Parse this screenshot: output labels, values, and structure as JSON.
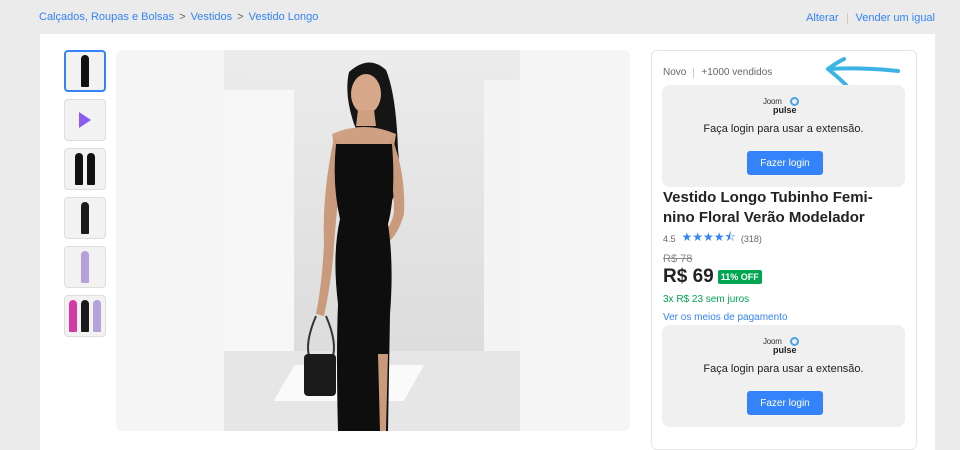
{
  "breadcrumb": {
    "items": [
      "Calçados, Roupas e Bolsas",
      "Vestidos",
      "Vestido Longo"
    ],
    "separator": ">"
  },
  "top_actions": {
    "edit_label": "Alterar",
    "sell_label": "Vender um igual"
  },
  "gallery": {
    "thumbnails": [
      "photo",
      "video",
      "photo",
      "photo",
      "photo",
      "photo"
    ]
  },
  "product": {
    "condition": "Novo",
    "sold": "+1000 vendidos",
    "title": "Vestido Longo Tubinho Feminino Floral Verão Modelador",
    "title_line1": "Vestido Longo Tubinho Femi-",
    "title_line2": "nino Floral Verão Modelador",
    "rating": "4.5",
    "stars": "★★★★⯪",
    "reviews": "(318)",
    "old_price": "R$ 78",
    "price": "R$ 69",
    "discount": "11% OFF",
    "installments": "3x R$ 23 sem juros",
    "payment_link": "Ver os meios de pagamento"
  },
  "promo": {
    "brand_top": "Joom",
    "brand_bottom": "pulse",
    "message": "Faça login para usar a extensão.",
    "button_label": "Fazer login"
  },
  "colors": {
    "accent": "#3483fa",
    "green": "#00a650",
    "annotation": "#3bb4e5"
  }
}
